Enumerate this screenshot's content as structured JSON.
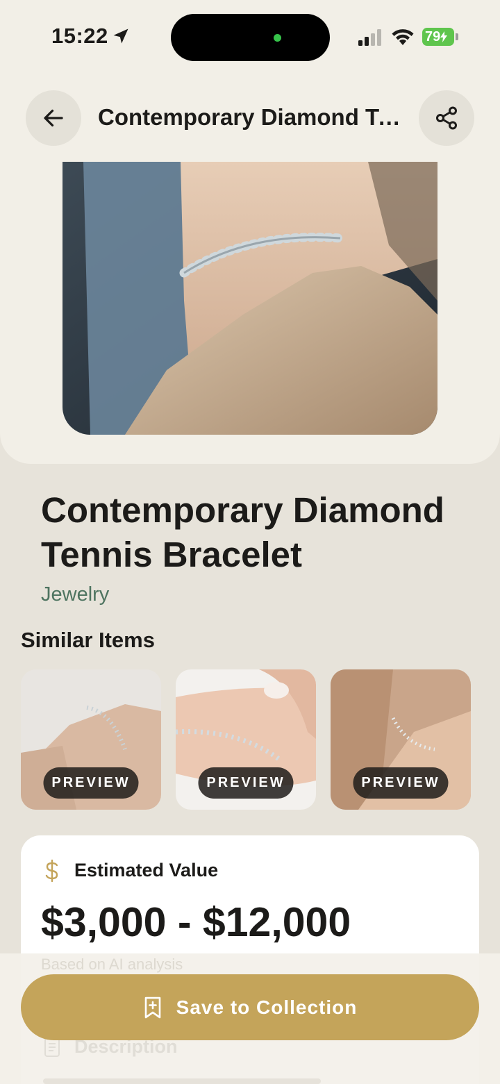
{
  "status_bar": {
    "time": "15:22",
    "battery": "79",
    "icons": [
      "location-arrow-icon",
      "signal-icon",
      "wifi-icon",
      "battery-charging-icon"
    ]
  },
  "header": {
    "title": "Contemporary Diamond Te...",
    "back_icon": "arrow-left-icon",
    "share_icon": "share-icon"
  },
  "item": {
    "title": "Contemporary Diamond Tennis Bracelet",
    "category": "Jewelry"
  },
  "similar": {
    "label": "Similar Items",
    "items": [
      {
        "button": "PREVIEW"
      },
      {
        "button": "PREVIEW"
      },
      {
        "button": "PREVIEW"
      }
    ]
  },
  "value": {
    "label": "Estimated Value",
    "range": "$3,000 - $12,000",
    "note": "Based on AI analysis",
    "icon": "dollar-icon"
  },
  "description": {
    "label": "Description",
    "icon": "document-icon"
  },
  "cta": {
    "label": "Save to Collection",
    "icon": "bookmark-add-icon"
  },
  "colors": {
    "accent": "#c4a45a",
    "category": "#4e7460",
    "background": "#e7e3da",
    "panel": "#f2efe7"
  }
}
